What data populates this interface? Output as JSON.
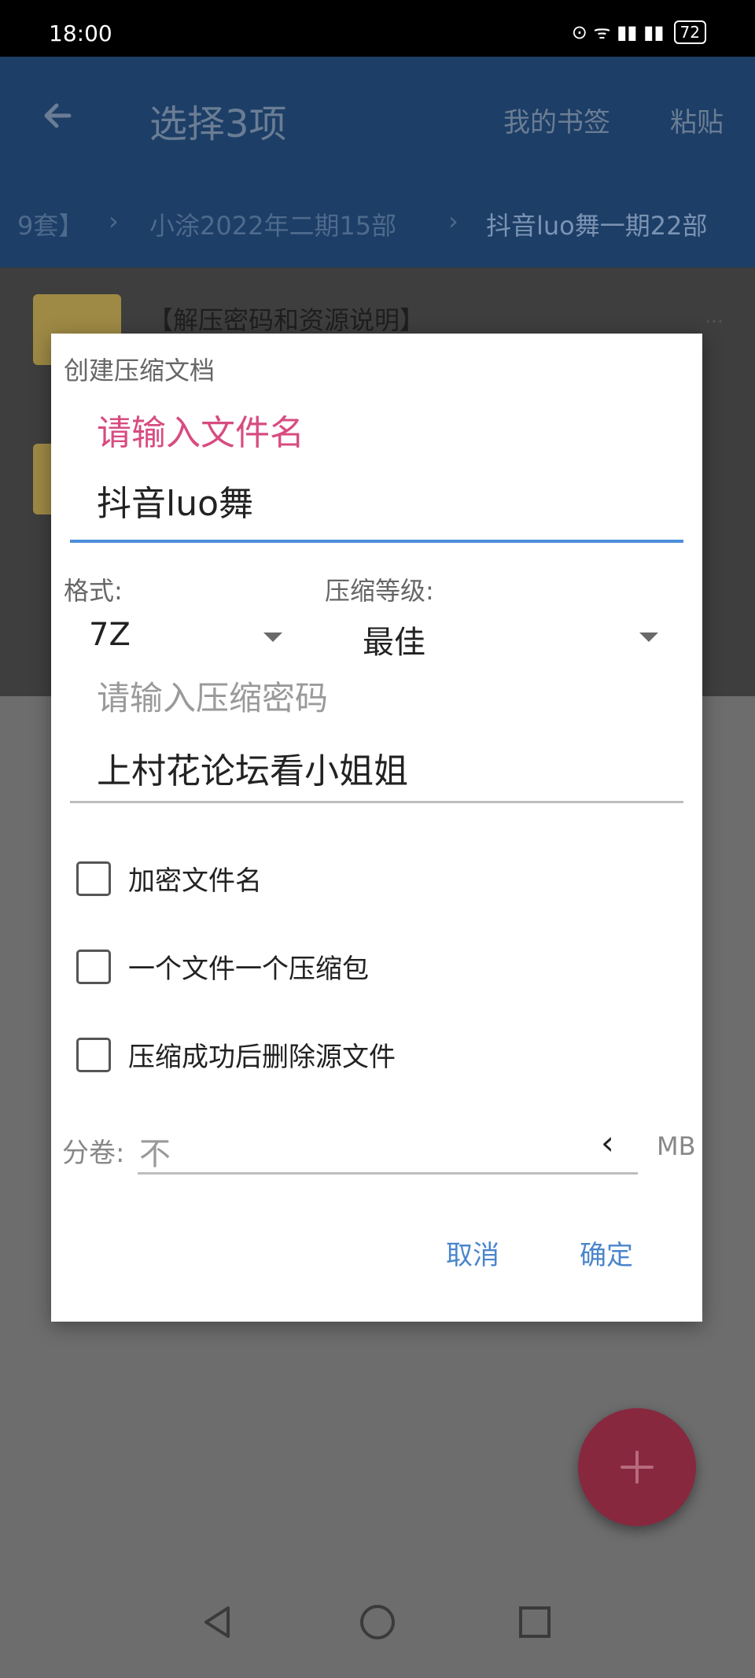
{
  "status_bar": {
    "time": "18:00",
    "signal_text": "⊙ ᯤ ▮▮ ▮▮",
    "battery": "72"
  },
  "app_bar": {
    "back_icon": "arrow-back-icon",
    "title": "选择3项",
    "actions": [
      "我的书签",
      "粘贴"
    ],
    "breadcrumbs": [
      "9套】",
      "小涂2022年二期15部",
      "抖音luo舞一期22部"
    ],
    "breadcrumb_separator": "›"
  },
  "list": {
    "items": [
      {
        "title": "【解压密码和资源说明】",
        "meta": "…"
      }
    ]
  },
  "dialog": {
    "title": "创建压缩文档",
    "filename_hint": "请输入文件名",
    "filename_value": "抖音luo舞",
    "format_label": "格式:",
    "format_value": "7Z",
    "level_label": "压缩等级:",
    "level_value": "最佳",
    "password_hint": "请输入压缩密码",
    "password_value": "上村花论坛看小姐姐",
    "options": [
      {
        "label": "加密文件名",
        "checked": false
      },
      {
        "label": "一个文件一个压缩包",
        "checked": false
      },
      {
        "label": "压缩成功后删除源文件",
        "checked": false
      }
    ],
    "volume_label": "分卷:",
    "volume_value": "不",
    "volume_chevron": "‹",
    "volume_unit": "MB",
    "cancel": "取消",
    "confirm": "确定"
  },
  "fab": {
    "icon": "plus-icon"
  },
  "nav_bar": {
    "icons": [
      "back-triangle-icon",
      "home-circle-icon",
      "recents-square-icon"
    ]
  },
  "colors": {
    "app_bar": "#1d3e66",
    "accent_pink": "#d74c80",
    "accent_blue": "#4a86cc",
    "fab": "#87283f"
  }
}
